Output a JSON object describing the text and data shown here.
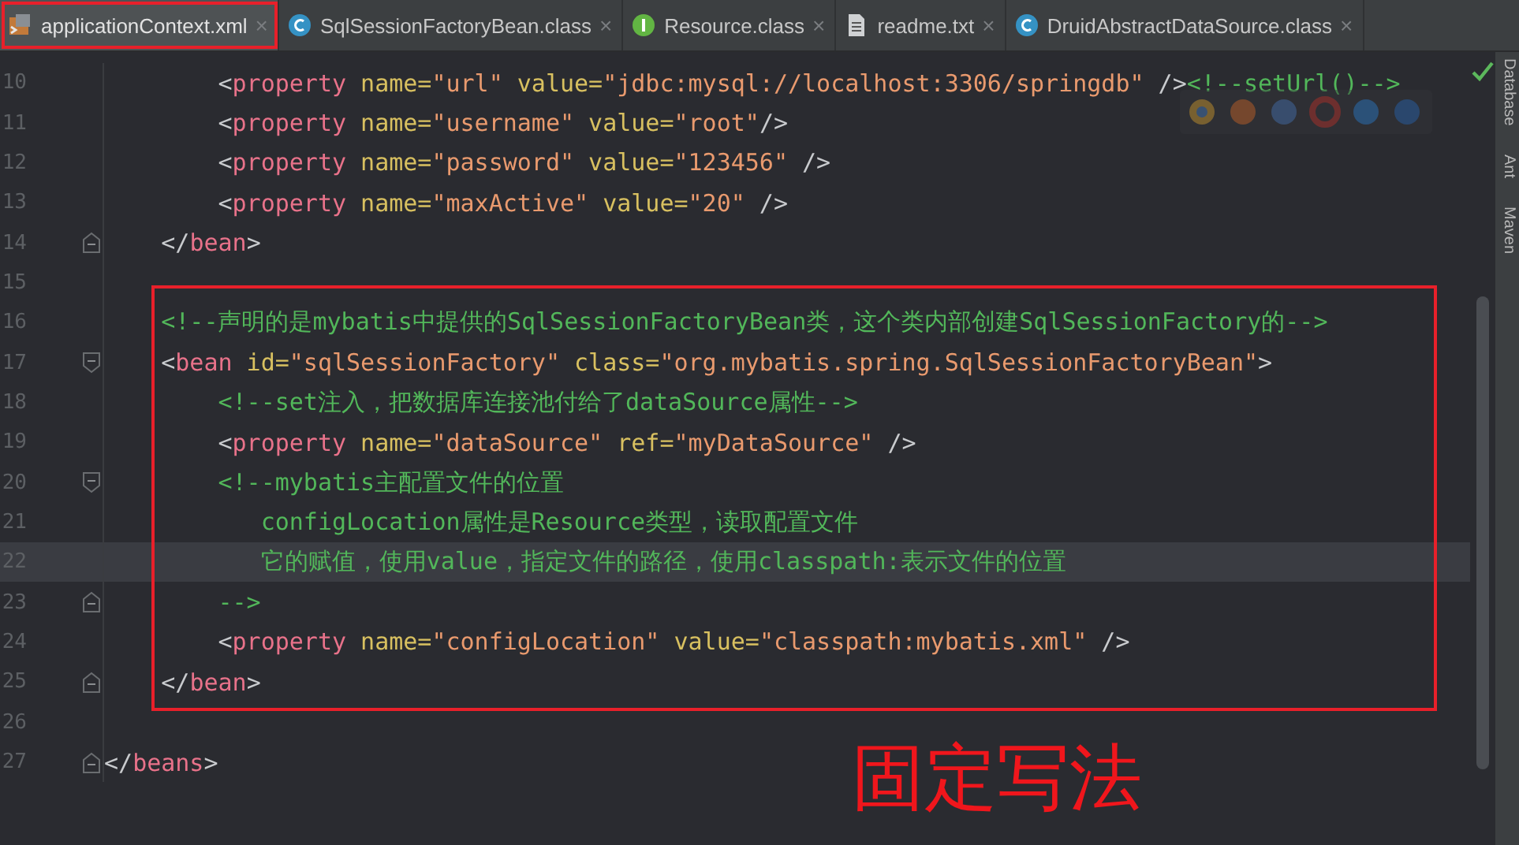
{
  "tabs": [
    {
      "label": "applicationContext.xml",
      "kind": "xml",
      "selected": true,
      "outlined": true,
      "close": "×"
    },
    {
      "label": "SqlSessionFactoryBean.class",
      "kind": "class",
      "selected": false,
      "outlined": false,
      "close": "×"
    },
    {
      "label": "Resource.class",
      "kind": "interface",
      "selected": false,
      "outlined": false,
      "close": "×"
    },
    {
      "label": "readme.txt",
      "kind": "text",
      "selected": false,
      "outlined": false,
      "close": "×"
    },
    {
      "label": "DruidAbstractDataSource.class",
      "kind": "class",
      "selected": false,
      "outlined": false,
      "close": "×"
    }
  ],
  "editor": {
    "lines": [
      {
        "number": "10",
        "tokens": [
          {
            "kind": "punct",
            "text": "        <"
          },
          {
            "kind": "tag",
            "text": "property"
          },
          {
            "kind": "attr",
            "text": " name="
          },
          {
            "kind": "string",
            "text": "\"url\""
          },
          {
            "kind": "attr",
            "text": " value="
          },
          {
            "kind": "string",
            "text": "\"jdbc:mysql://localhost:3306/springdb\""
          },
          {
            "kind": "punct",
            "text": " />"
          },
          {
            "kind": "comment",
            "text": "<!--setUrl()-->"
          }
        ]
      },
      {
        "number": "11",
        "tokens": [
          {
            "kind": "punct",
            "text": "        <"
          },
          {
            "kind": "tag",
            "text": "property"
          },
          {
            "kind": "attr",
            "text": " name="
          },
          {
            "kind": "string",
            "text": "\"username\""
          },
          {
            "kind": "attr",
            "text": " value="
          },
          {
            "kind": "string",
            "text": "\"root\""
          },
          {
            "kind": "punct",
            "text": "/>"
          }
        ]
      },
      {
        "number": "12",
        "tokens": [
          {
            "kind": "punct",
            "text": "        <"
          },
          {
            "kind": "tag",
            "text": "property"
          },
          {
            "kind": "attr",
            "text": " name="
          },
          {
            "kind": "string",
            "text": "\"password\""
          },
          {
            "kind": "attr",
            "text": " value="
          },
          {
            "kind": "string",
            "text": "\"123456\""
          },
          {
            "kind": "punct",
            "text": " />"
          }
        ]
      },
      {
        "number": "13",
        "tokens": [
          {
            "kind": "punct",
            "text": "        <"
          },
          {
            "kind": "tag",
            "text": "property"
          },
          {
            "kind": "attr",
            "text": " name="
          },
          {
            "kind": "string",
            "text": "\"maxActive\""
          },
          {
            "kind": "attr",
            "text": " value="
          },
          {
            "kind": "string",
            "text": "\"20\""
          },
          {
            "kind": "punct",
            "text": " />"
          }
        ]
      },
      {
        "number": "14",
        "fold_end": true,
        "tokens": [
          {
            "kind": "punct",
            "text": "    </"
          },
          {
            "kind": "tag",
            "text": "bean"
          },
          {
            "kind": "punct",
            "text": ">"
          }
        ]
      },
      {
        "number": "15"
      },
      {
        "number": "16",
        "tokens": [
          {
            "kind": "comment",
            "text": "    <!--声明的是mybatis中提供的SqlSessionFactoryBean类，这个类内部创建SqlSessionFactory的-->"
          }
        ]
      },
      {
        "number": "17",
        "fold_start": true,
        "tokens": [
          {
            "kind": "punct",
            "text": "    <"
          },
          {
            "kind": "tag",
            "text": "bean"
          },
          {
            "kind": "attr",
            "text": " id="
          },
          {
            "kind": "string",
            "text": "\"sqlSessionFactory\""
          },
          {
            "kind": "attr",
            "text": " class="
          },
          {
            "kind": "string",
            "text": "\"org.mybatis.spring.SqlSessionFactoryBean\""
          },
          {
            "kind": "punct",
            "text": ">"
          }
        ]
      },
      {
        "number": "18",
        "tokens": [
          {
            "kind": "comment",
            "text": "        <!--set注入，把数据库连接池付给了dataSource属性-->"
          }
        ]
      },
      {
        "number": "19",
        "tokens": [
          {
            "kind": "punct",
            "text": "        <"
          },
          {
            "kind": "tag",
            "text": "property"
          },
          {
            "kind": "attr",
            "text": " name="
          },
          {
            "kind": "string",
            "text": "\"dataSource\""
          },
          {
            "kind": "attr",
            "text": " ref="
          },
          {
            "kind": "string",
            "text": "\"myDataSource\""
          },
          {
            "kind": "punct",
            "text": " />"
          }
        ]
      },
      {
        "number": "20",
        "fold_start": true,
        "tokens": [
          {
            "kind": "comment",
            "text": "        <!--mybatis主配置文件的位置"
          }
        ]
      },
      {
        "number": "21",
        "tokens": [
          {
            "kind": "comment",
            "text": "           configLocation属性是Resource类型，读取配置文件"
          }
        ]
      },
      {
        "number": "22",
        "current": true,
        "tokens": [
          {
            "kind": "comment",
            "text": "           它的赋值，使用value，指定文件的路径，使用classpath:表示文件的位置"
          }
        ]
      },
      {
        "number": "23",
        "fold_end": true,
        "tokens": [
          {
            "kind": "comment",
            "text": "        -->"
          }
        ]
      },
      {
        "number": "24",
        "tokens": [
          {
            "kind": "punct",
            "text": "        <"
          },
          {
            "kind": "tag",
            "text": "property"
          },
          {
            "kind": "attr",
            "text": " name="
          },
          {
            "kind": "string",
            "text": "\"configLocation\""
          },
          {
            "kind": "attr",
            "text": " value="
          },
          {
            "kind": "string",
            "text": "\"classpath:mybatis.xml\""
          },
          {
            "kind": "punct",
            "text": " />"
          }
        ]
      },
      {
        "number": "25",
        "fold_end": true,
        "tokens": [
          {
            "kind": "punct",
            "text": "    </"
          },
          {
            "kind": "tag",
            "text": "bean"
          },
          {
            "kind": "punct",
            "text": ">"
          }
        ]
      },
      {
        "number": "26"
      },
      {
        "number": "27",
        "fold_end": true,
        "tokens": [
          {
            "kind": "punct",
            "text": "</"
          },
          {
            "kind": "tag",
            "text": "beans"
          },
          {
            "kind": "punct",
            "text": ">"
          }
        ]
      }
    ]
  },
  "annotation": {
    "text": "固定写法"
  },
  "tool_strip": [
    "Database",
    "Ant",
    "Maven"
  ]
}
